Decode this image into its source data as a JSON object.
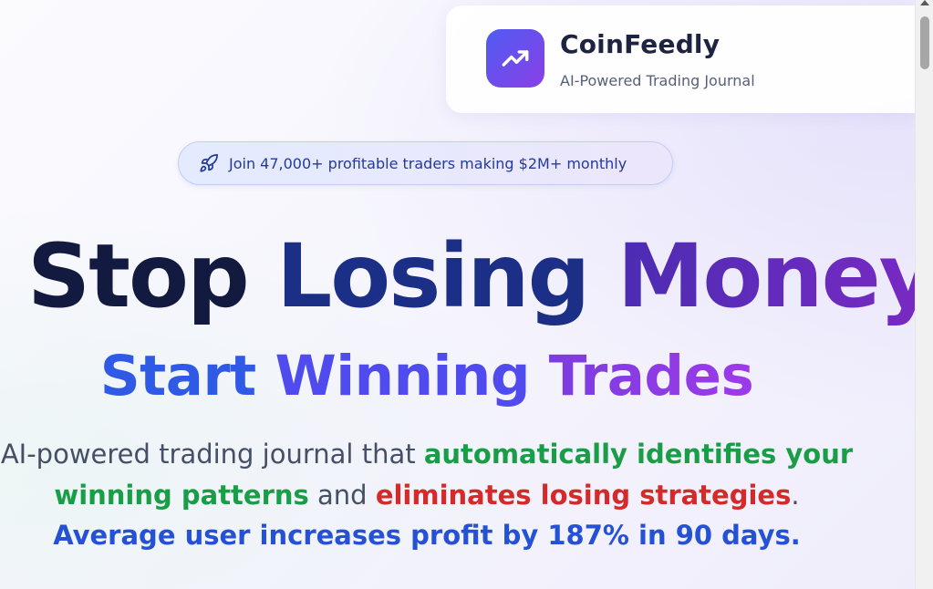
{
  "brand": {
    "name": "CoinFeedly",
    "tagline": "AI-Powered Trading Journal",
    "logo_icon": "trending-up-icon"
  },
  "social_proof": {
    "icon": "rocket-icon",
    "text": "Join 47,000+ profitable traders making $2M+ monthly"
  },
  "hero": {
    "headline": [
      "Stop",
      "Losing",
      "Money"
    ],
    "subheadline": [
      "Start",
      "Winning",
      "Trades"
    ],
    "description": {
      "part1": "AI-powered trading journal that ",
      "highlight_green_1": "automatically identifies your winning patterns",
      "part2": " and ",
      "highlight_red": "eliminates losing strategies",
      "part3": ".",
      "highlight_blue": "Average user increases profit by 187% in 90 days."
    }
  },
  "colors": {
    "accent_green": "#1a9d47",
    "accent_red": "#d42a2a",
    "accent_blue": "#2551d4",
    "brand_gradient_start": "#4f5cf2",
    "brand_gradient_end": "#8a3fe6"
  }
}
